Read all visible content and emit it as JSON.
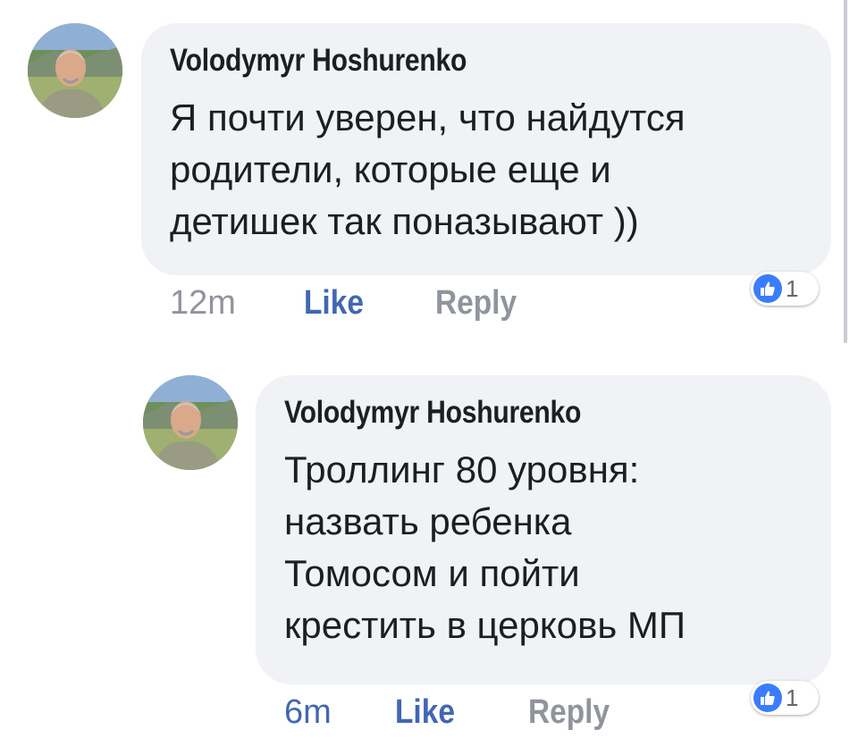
{
  "comments": [
    {
      "author": "Volodymyr Hoshurenko",
      "lines": [
        "Я почти уверен, что найдутся",
        "родители, которые еще и",
        "детишек так поназывают ))"
      ],
      "time": "12m",
      "like_label": "Like",
      "reply_label": "Reply",
      "reaction_count": "1",
      "reaction_icon": "thumbs-up-icon"
    },
    {
      "author": "Volodymyr Hoshurenko",
      "lines": [
        "Троллинг 80 уровня:",
        "назвать ребенка",
        "Томосом и пойти",
        "крестить в церковь МП"
      ],
      "time": "6m",
      "like_label": "Like",
      "reply_label": "Reply",
      "reaction_count": "1",
      "reaction_icon": "thumbs-up-icon"
    }
  ],
  "colors": {
    "like_blue": "#4267b2",
    "bubble_gray": "#f0f2f5",
    "meta_gray": "#90949c",
    "reaction_blue": "#3b7cff"
  }
}
